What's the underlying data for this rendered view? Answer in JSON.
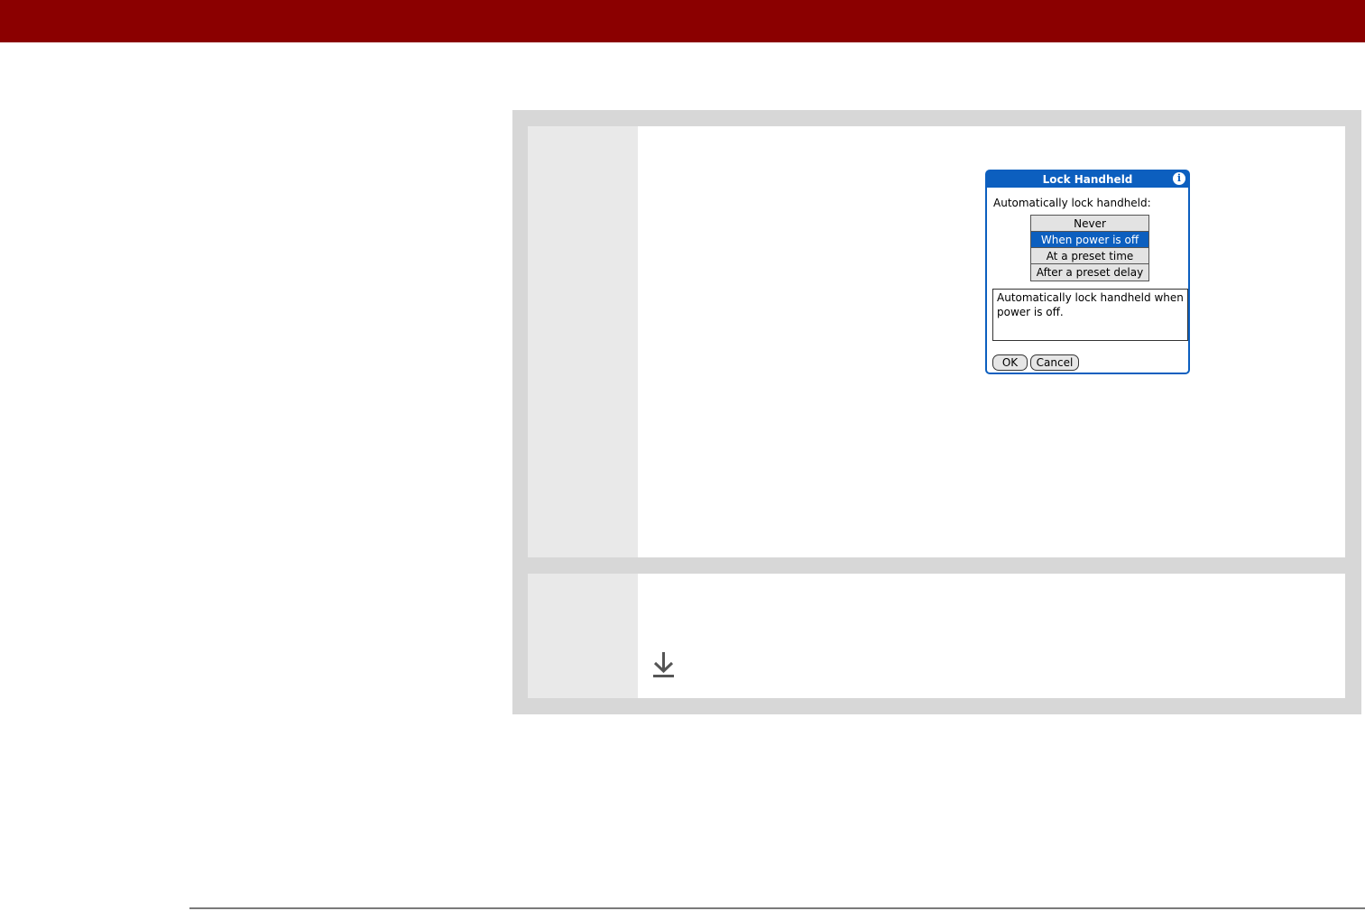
{
  "colors": {
    "header_bar": "#8b0000",
    "palm_blue": "#0c5fbf",
    "panel_gray": "#d7d7d7",
    "column_gray": "#e9e9e9"
  },
  "dialog": {
    "title": "Lock Handheld",
    "info_icon": "info-icon",
    "info_glyph": "i",
    "prompt": "Automatically lock handheld:",
    "options": [
      "Never",
      "When power is off",
      "At a preset time",
      "After a preset delay"
    ],
    "selected_option": "When power is off",
    "description": "Automatically lock handheld when power is off.",
    "ok_label": "OK",
    "cancel_label": "Cancel"
  },
  "icons": {
    "continue_arrow": "arrow-down-to-line-icon"
  }
}
